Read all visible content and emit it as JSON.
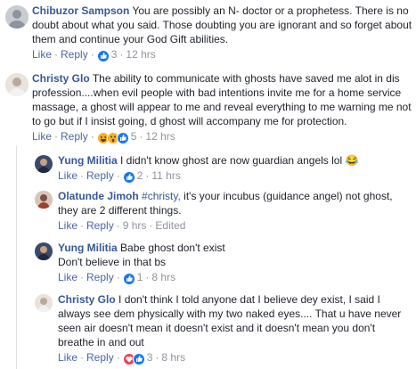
{
  "comments": [
    {
      "author": "Chibuzor Sampson",
      "text": "You are possibly an N- doctor or a prophetess. There is no doubt about what you said. Those doubting you are ignorant and so forget about them and continue your God Gift abilities.",
      "like": "Like",
      "reply": "Reply",
      "reaction_count": "3",
      "reaction_icons": [
        "like-icon"
      ],
      "time": "12 hrs"
    },
    {
      "author": "Christy Glo",
      "text": "The ability to communicate with ghosts have saved me alot in dis profession....when evil people with bad intentions invite me for a home service massage, a ghost will appear to me and reveal everything to me warning me not to go but if I insist going, d ghost will accompany me for protection.",
      "like": "Like",
      "reply": "Reply",
      "reaction_count": "5",
      "reaction_icons": [
        "haha-icon",
        "wow-icon",
        "like-icon"
      ],
      "time": "12 hrs"
    },
    {
      "author": "Yung Militia",
      "text": "I didn't know ghost are now guardian angels lol 😂",
      "like": "Like",
      "reply": "Reply",
      "reaction_count": "2",
      "reaction_icons": [
        "like-icon"
      ],
      "time": "11 hrs"
    },
    {
      "author": "Olatunde Jimoh",
      "mention": "#christy,",
      "text": "it's your incubus (guidance angel) not ghost, they are 2 different things.",
      "like": "Like",
      "reply": "Reply",
      "time": "9 hrs",
      "edited": "Edited"
    },
    {
      "author": "Yung Militia",
      "text": "Babe ghost don't exist",
      "text2": "Don't believe in that bs",
      "like": "Like",
      "reply": "Reply",
      "reaction_count": "1",
      "reaction_icons": [
        "like-icon"
      ],
      "time": "8 hrs"
    },
    {
      "author": "Christy Glo",
      "text": "I don't think I told anyone dat I believe dey exist, I said I always see dem physically with my two naked eyes.... That u have never seen air doesn't mean it doesn't exist and it doesn't mean you don't breathe in and out",
      "like": "Like",
      "reply": "Reply",
      "reaction_count": "3",
      "reaction_icons": [
        "love-icon",
        "like-icon"
      ],
      "time": "8 hrs"
    }
  ],
  "separator": "·",
  "colors": {
    "author": "#365899",
    "action": "#4b67a1",
    "meta": "#90949c",
    "text": "#1d2129"
  }
}
